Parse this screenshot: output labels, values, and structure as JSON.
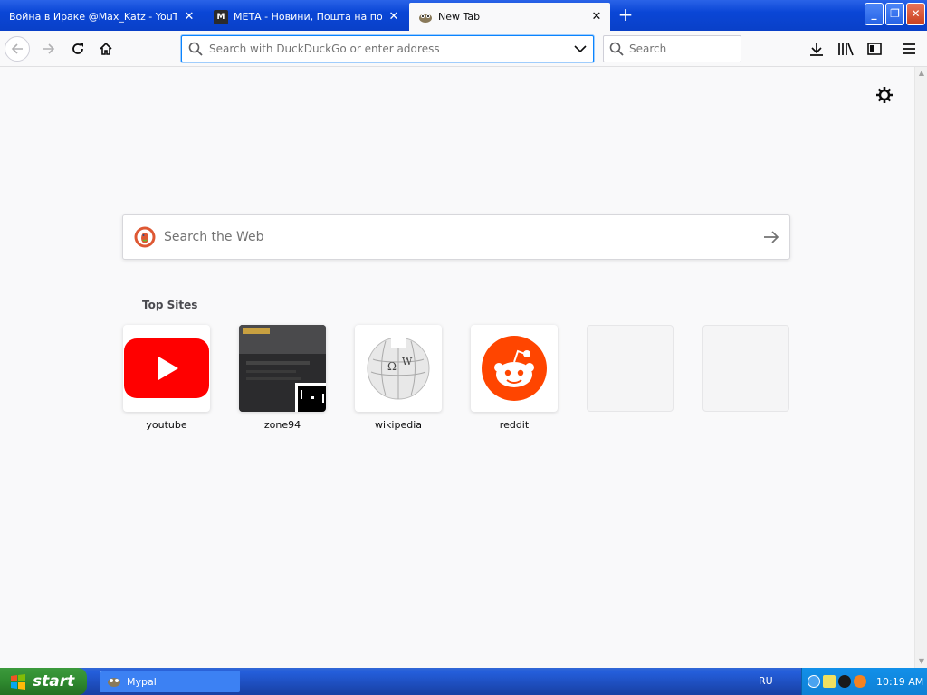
{
  "tabs": [
    {
      "title": "Война в Ираке @Max_Katz - YouTube"
    },
    {
      "title": "МЕТА - Новини, Пошта на портал",
      "favicon": "M"
    },
    {
      "title": "New Tab"
    }
  ],
  "urlbar": {
    "placeholder": "Search with DuckDuckGo or enter address"
  },
  "searchbar": {
    "placeholder": "Search"
  },
  "websearch": {
    "placeholder": "Search the Web"
  },
  "top_sites": {
    "title": "Top Sites",
    "sites": [
      {
        "label": "youtube"
      },
      {
        "label": "zone94"
      },
      {
        "label": "wikipedia"
      },
      {
        "label": "reddit"
      },
      {
        "label": ""
      },
      {
        "label": ""
      }
    ]
  },
  "taskbar": {
    "start_label": "start",
    "task_label": "Mypal",
    "lang": "RU",
    "clock": "10:19 AM"
  },
  "colors": {
    "accent": "#0a84ff",
    "youtube": "#ff0000",
    "reddit": "#ff4500",
    "xp_blue": "#245edb"
  }
}
